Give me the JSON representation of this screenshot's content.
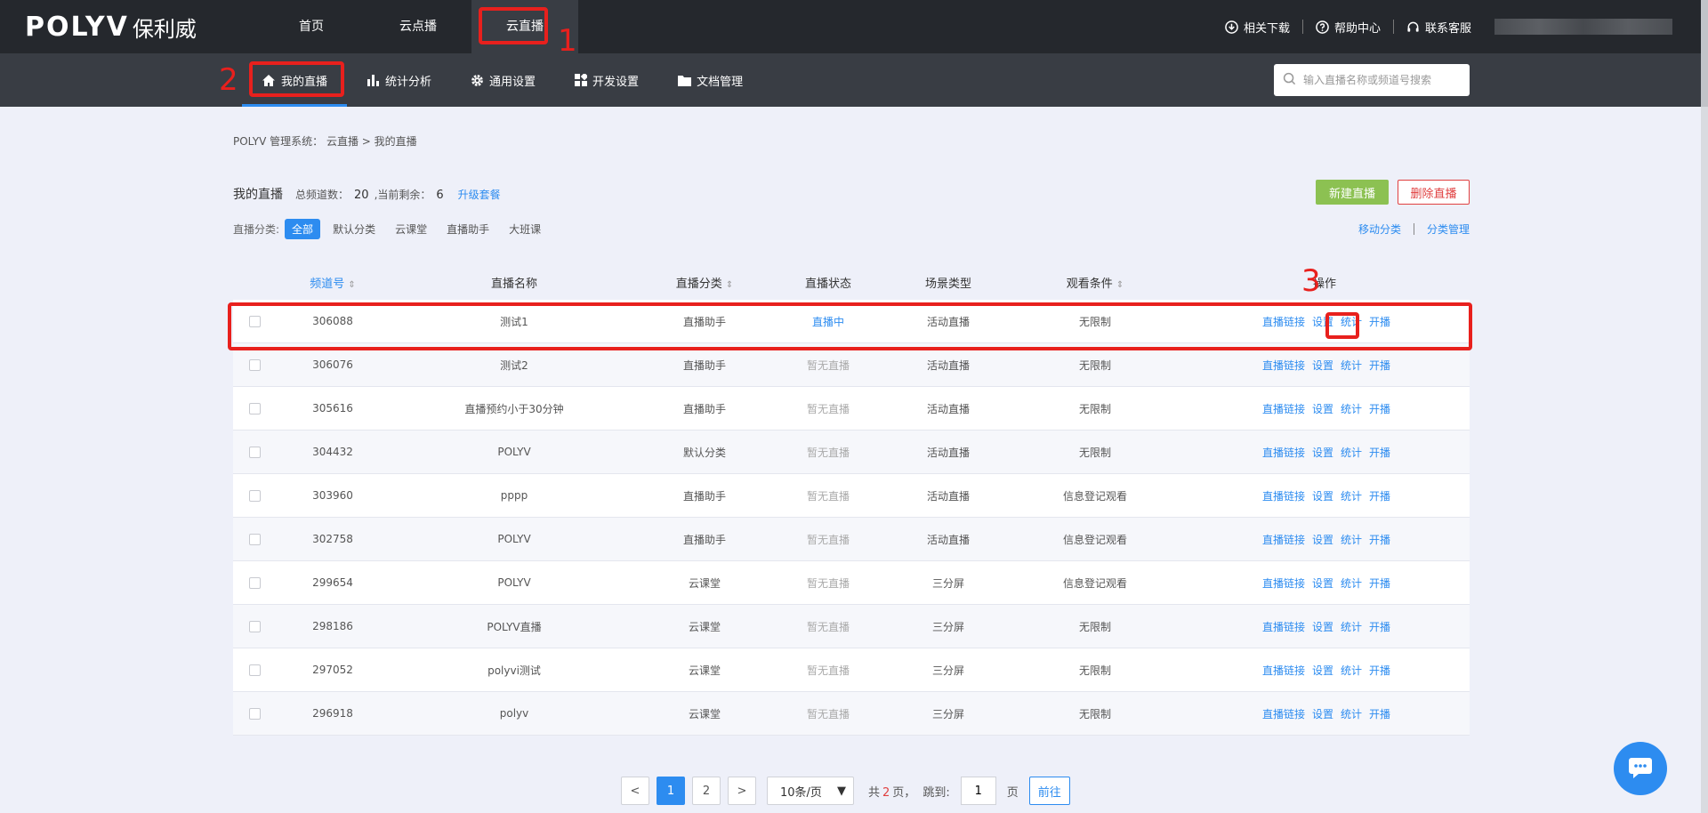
{
  "brand": {
    "latin": "POLYV",
    "cjk": "保利威"
  },
  "topnav": [
    {
      "label": "首页"
    },
    {
      "label": "云点播"
    },
    {
      "label": "云直播",
      "active": true
    }
  ],
  "topright": {
    "download": "相关下载",
    "help": "帮助中心",
    "service": "联系客服"
  },
  "subnav": [
    {
      "label": "我的直播",
      "icon": "home-icon"
    },
    {
      "label": "统计分析",
      "icon": "bar-chart-icon"
    },
    {
      "label": "通用设置",
      "icon": "gear-icon"
    },
    {
      "label": "开发设置",
      "icon": "grid-icon"
    },
    {
      "label": "文档管理",
      "icon": "folder-icon"
    }
  ],
  "search": {
    "placeholder": "输入直播名称或频道号搜索"
  },
  "breadcrumb": "POLYV 管理系统：  云直播 > 我的直播",
  "header": {
    "title": "我的直播",
    "total_label": "总频道数：",
    "total": "20",
    "remain_label": ",当前剩余：",
    "remain": "6",
    "upgrade": "升级套餐",
    "new_button": "新建直播",
    "delete_button": "删除直播"
  },
  "filter": {
    "label": "直播分类:",
    "chips": [
      "全部",
      "默认分类",
      "云课堂",
      "直播助手",
      "大班课"
    ],
    "move": "移动分类",
    "manage": "分类管理"
  },
  "table": {
    "columns": [
      "频道号",
      "直播名称",
      "直播分类",
      "直播状态",
      "场景类型",
      "观看条件",
      "操作"
    ],
    "ops": [
      "直播链接",
      "设置",
      "统计",
      "开播"
    ],
    "rows": [
      {
        "id": "306088",
        "name": "测试1",
        "category": "直播助手",
        "status": "直播中",
        "scene": "活动直播",
        "condition": "无限制"
      },
      {
        "id": "306076",
        "name": "测试2",
        "category": "直播助手",
        "status": "暂无直播",
        "scene": "活动直播",
        "condition": "无限制"
      },
      {
        "id": "305616",
        "name": "直播预约小于30分钟",
        "category": "直播助手",
        "status": "暂无直播",
        "scene": "活动直播",
        "condition": "无限制"
      },
      {
        "id": "304432",
        "name": "POLYV",
        "category": "默认分类",
        "status": "暂无直播",
        "scene": "活动直播",
        "condition": "无限制"
      },
      {
        "id": "303960",
        "name": "pppp",
        "category": "直播助手",
        "status": "暂无直播",
        "scene": "活动直播",
        "condition": "信息登记观看"
      },
      {
        "id": "302758",
        "name": "POLYV",
        "category": "直播助手",
        "status": "暂无直播",
        "scene": "活动直播",
        "condition": "信息登记观看"
      },
      {
        "id": "299654",
        "name": "POLYV",
        "category": "云课堂",
        "status": "暂无直播",
        "scene": "三分屏",
        "condition": "信息登记观看"
      },
      {
        "id": "298186",
        "name": "POLYV直播",
        "category": "云课堂",
        "status": "暂无直播",
        "scene": "三分屏",
        "condition": "无限制"
      },
      {
        "id": "297052",
        "name": "polyvi测试",
        "category": "云课堂",
        "status": "暂无直播",
        "scene": "三分屏",
        "condition": "无限制"
      },
      {
        "id": "296918",
        "name": "polyv",
        "category": "云课堂",
        "status": "暂无直播",
        "scene": "三分屏",
        "condition": "无限制"
      }
    ]
  },
  "pager": {
    "prev": "<",
    "pages": [
      "1",
      "2"
    ],
    "next": ">",
    "size": "10条/页",
    "total_prefix": "共",
    "total_pages": "2",
    "total_suffix": "页，",
    "jump_label": "跳到:",
    "jump_value": "1",
    "page_unit": "页",
    "go": "前往"
  },
  "annotations": [
    "1",
    "2",
    "3"
  ],
  "colors": {
    "accent": "#2d8cf0",
    "highlight": "#e8201d",
    "new_button": "#8cc152",
    "delete": "#e04040"
  }
}
